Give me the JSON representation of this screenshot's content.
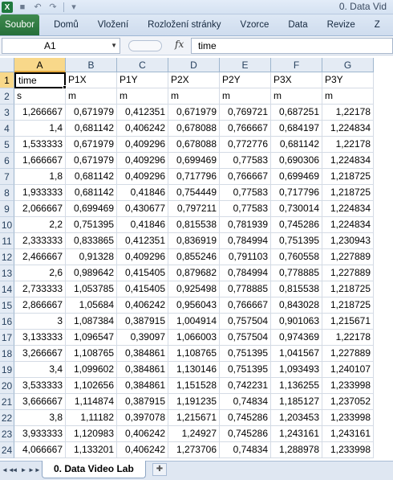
{
  "app": {
    "logo_letter": "X",
    "window_title": "0. Data Vid"
  },
  "qat_icons": [
    "save-icon",
    "undo-icon",
    "redo-icon",
    "customize-icon"
  ],
  "ribbon": {
    "tabs": [
      "Soubor",
      "Domů",
      "Vložení",
      "Rozložení stránky",
      "Vzorce",
      "Data",
      "Revize",
      "Z"
    ]
  },
  "formula_bar": {
    "name_box": "A1",
    "fx": "fx",
    "content": "time"
  },
  "columns": [
    "A",
    "B",
    "C",
    "D",
    "E",
    "F",
    "G"
  ],
  "rows": [
    [
      "time",
      "P1X",
      "P1Y",
      "P2X",
      "P2Y",
      "P3X",
      "P3Y"
    ],
    [
      "s",
      "m",
      "m",
      "m",
      "m",
      "m",
      "m"
    ],
    [
      "1,266667",
      "0,671979",
      "0,412351",
      "0,671979",
      "0,769721",
      "0,687251",
      "1,22178"
    ],
    [
      "1,4",
      "0,681142",
      "0,406242",
      "0,678088",
      "0,766667",
      "0,684197",
      "1,224834"
    ],
    [
      "1,533333",
      "0,671979",
      "0,409296",
      "0,678088",
      "0,772776",
      "0,681142",
      "1,22178"
    ],
    [
      "1,666667",
      "0,671979",
      "0,409296",
      "0,699469",
      "0,77583",
      "0,690306",
      "1,224834"
    ],
    [
      "1,8",
      "0,681142",
      "0,409296",
      "0,717796",
      "0,766667",
      "0,699469",
      "1,218725"
    ],
    [
      "1,933333",
      "0,681142",
      "0,41846",
      "0,754449",
      "0,77583",
      "0,717796",
      "1,218725"
    ],
    [
      "2,066667",
      "0,699469",
      "0,430677",
      "0,797211",
      "0,77583",
      "0,730014",
      "1,224834"
    ],
    [
      "2,2",
      "0,751395",
      "0,41846",
      "0,815538",
      "0,781939",
      "0,745286",
      "1,224834"
    ],
    [
      "2,333333",
      "0,833865",
      "0,412351",
      "0,836919",
      "0,784994",
      "0,751395",
      "1,230943"
    ],
    [
      "2,466667",
      "0,91328",
      "0,409296",
      "0,855246",
      "0,791103",
      "0,760558",
      "1,227889"
    ],
    [
      "2,6",
      "0,989642",
      "0,415405",
      "0,879682",
      "0,784994",
      "0,778885",
      "1,227889"
    ],
    [
      "2,733333",
      "1,053785",
      "0,415405",
      "0,925498",
      "0,778885",
      "0,815538",
      "1,218725"
    ],
    [
      "2,866667",
      "1,05684",
      "0,406242",
      "0,956043",
      "0,766667",
      "0,843028",
      "1,218725"
    ],
    [
      "3",
      "1,087384",
      "0,387915",
      "1,004914",
      "0,757504",
      "0,901063",
      "1,215671"
    ],
    [
      "3,133333",
      "1,096547",
      "0,39097",
      "1,066003",
      "0,757504",
      "0,974369",
      "1,22178"
    ],
    [
      "3,266667",
      "1,108765",
      "0,384861",
      "1,108765",
      "0,751395",
      "1,041567",
      "1,227889"
    ],
    [
      "3,4",
      "1,099602",
      "0,384861",
      "1,130146",
      "0,751395",
      "1,093493",
      "1,240107"
    ],
    [
      "3,533333",
      "1,102656",
      "0,384861",
      "1,151528",
      "0,742231",
      "1,136255",
      "1,233998"
    ],
    [
      "3,666667",
      "1,114874",
      "0,387915",
      "1,191235",
      "0,74834",
      "1,185127",
      "1,237052"
    ],
    [
      "3,8",
      "1,11182",
      "0,397078",
      "1,215671",
      "0,745286",
      "1,203453",
      "1,233998"
    ],
    [
      "3,933333",
      "1,120983",
      "0,406242",
      "1,24927",
      "0,745286",
      "1,243161",
      "1,243161"
    ],
    [
      "4,066667",
      "1,133201",
      "0,406242",
      "1,273706",
      "0,74834",
      "1,288978",
      "1,233998"
    ]
  ],
  "sheet_tabs": {
    "nav": [
      "◄◄",
      "◄",
      "►",
      "►►"
    ],
    "active": "0. Data Video Lab",
    "new_sheet_icon": "insert-sheet-icon"
  }
}
